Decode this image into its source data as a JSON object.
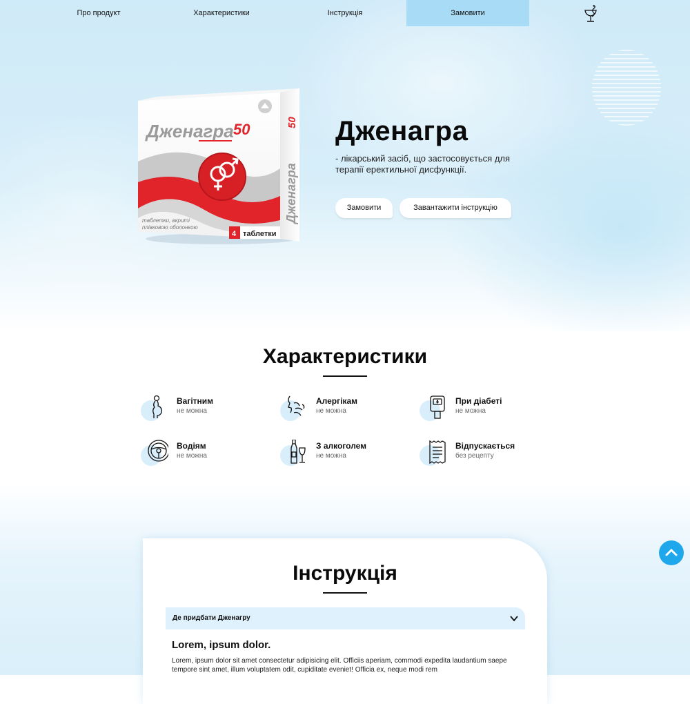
{
  "nav": {
    "items": [
      {
        "label": "Про продукт"
      },
      {
        "label": "Характеристики"
      },
      {
        "label": "Інструкція"
      },
      {
        "label": "Замовити",
        "active": true
      }
    ],
    "logo_icon": "pharmacy-bowl-snake-icon"
  },
  "product_box": {
    "brand": "Дженагра",
    "dose": "50",
    "subtitle_line1": "таблетки, вкриті",
    "subtitle_line2": "плівковою оболонкою",
    "count": "4",
    "count_label": "таблетки"
  },
  "hero": {
    "title": "Дженагра",
    "description": "- лікарський засіб, що застосовується для терапії еректильної дисфункції.",
    "order_button": "Замовити",
    "download_button": "Завантажити інструкцію"
  },
  "characteristics": {
    "title": "Характеристики",
    "items": [
      {
        "title": "Вагітним",
        "sub": "не можна",
        "icon": "pregnant-icon"
      },
      {
        "title": "Алергікам",
        "sub": "не можна",
        "icon": "allergy-icon"
      },
      {
        "title": "При діабеті",
        "sub": "не можна",
        "icon": "glucometer-icon"
      },
      {
        "title": "Водіям",
        "sub": "не можна",
        "icon": "steering-wheel-icon"
      },
      {
        "title": "З алкоголем",
        "sub": "не можна",
        "icon": "alcohol-icon"
      },
      {
        "title": "Відпускається",
        "sub": "без рецепту",
        "icon": "receipt-icon"
      }
    ]
  },
  "instruction": {
    "title": "Інструкція",
    "accordion_label": "Де придбати Дженагру",
    "lorem_title": "Lorem, ipsum dolor.",
    "lorem_text": "Lorem, ipsum dolor sit amet consectetur adipisicing elit. Officiis aperiam, commodi expedita laudantium saepe tempore sint amet, illum voluptatem odit, cupiditate eveniet! Officia ex, neque modi rem"
  },
  "colors": {
    "accent_blue": "#1ea7ea",
    "nav_active": "#a8dbf5",
    "box_red": "#e0242a"
  }
}
